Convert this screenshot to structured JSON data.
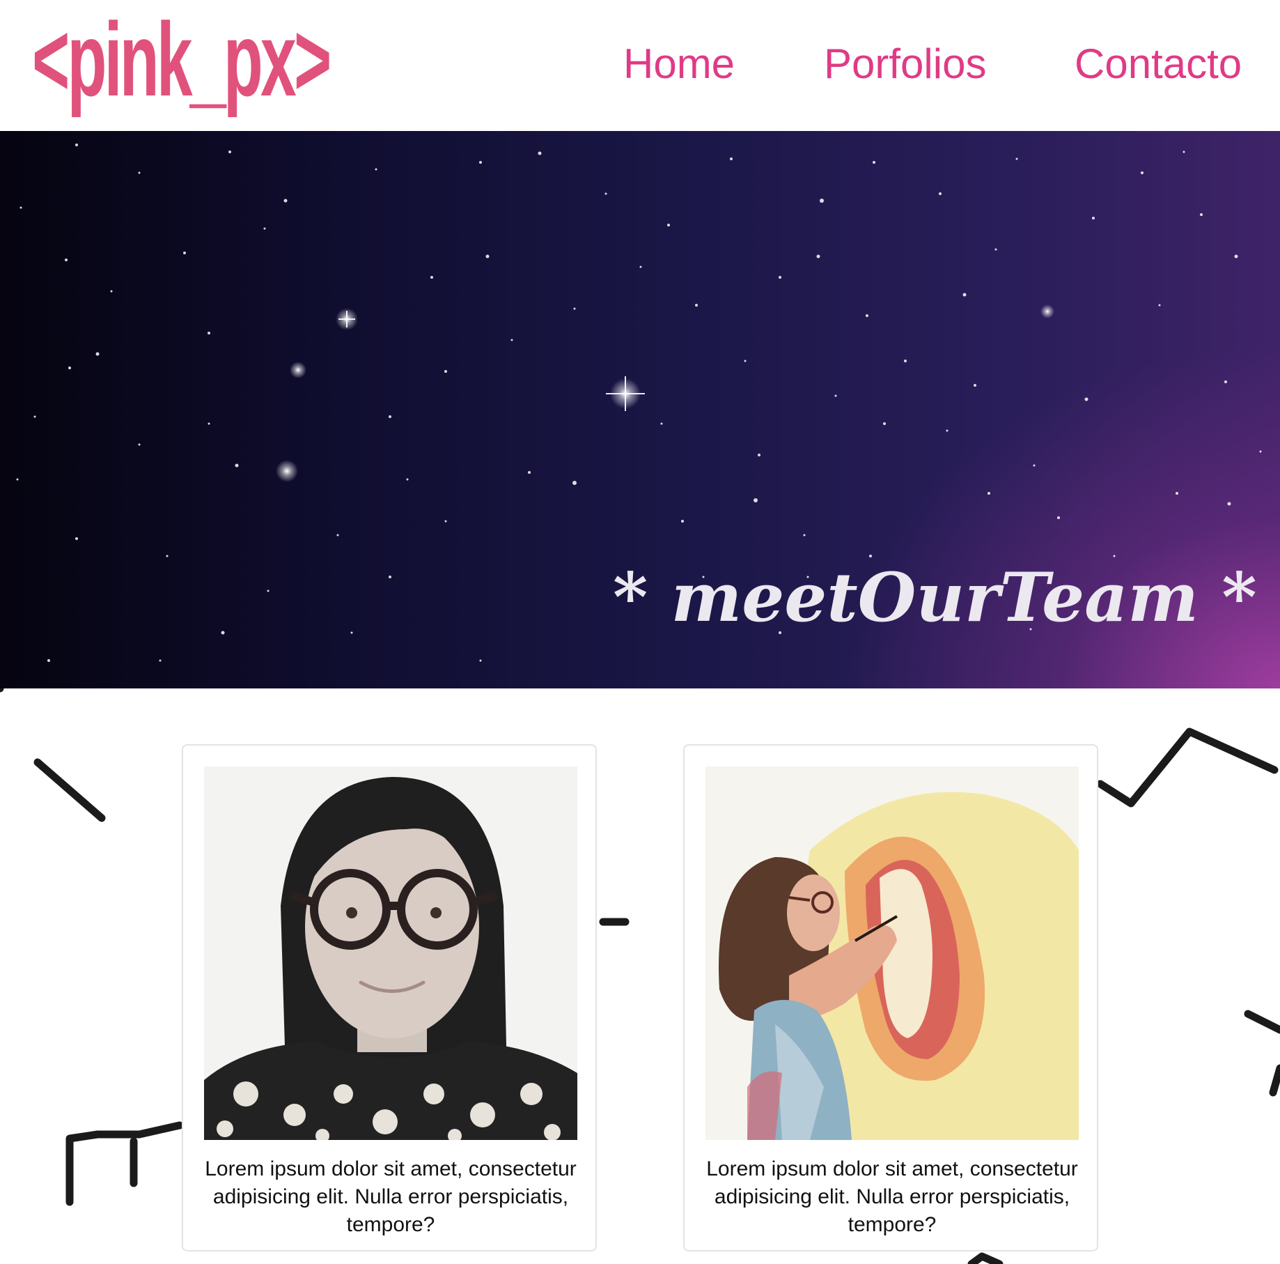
{
  "header": {
    "logo": "<pink_px>",
    "nav": {
      "home": "Home",
      "portfolios": "Porfolios",
      "contact": "Contacto"
    }
  },
  "hero": {
    "title": "* meetOurTeam *"
  },
  "team": [
    {
      "photo_icon": "portrait-photo-woman-glasses",
      "description": "Lorem ipsum dolor sit amet, consectetur adipisicing elit. Nulla error perspiciatis, tempore?"
    },
    {
      "photo_icon": "portrait-photo-woman-painting",
      "description": "Lorem ipsum dolor sit amet, consectetur adipisicing elit. Nulla error perspiciatis, tempore?"
    }
  ],
  "colors": {
    "brand_pink": "#e0527c",
    "nav_pink": "#e03a86",
    "hero_dark": "#0f0d2e",
    "hero_purple": "#a33ea0"
  }
}
